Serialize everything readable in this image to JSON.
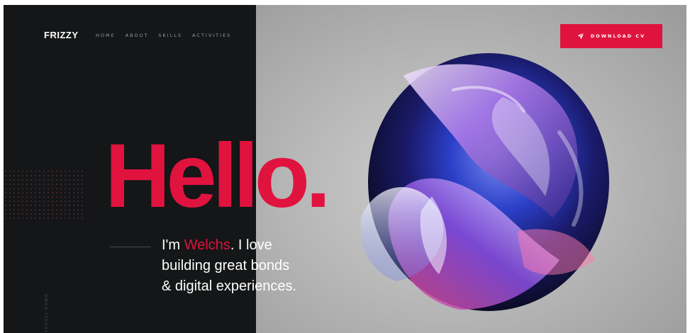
{
  "brand": {
    "logo": "FRIZZY"
  },
  "nav": {
    "items": [
      {
        "label": "HOME"
      },
      {
        "label": "ABOUT"
      },
      {
        "label": "SKILLS"
      },
      {
        "label": "ACTIVITIES"
      }
    ]
  },
  "header": {
    "cta_label": "DOWNLOAD CV",
    "cta_icon": "send-icon"
  },
  "hero": {
    "headline": "Hello.",
    "intro_prefix": "I'm ",
    "intro_name": "Welchs",
    "intro_line1_rest": ". I love",
    "intro_line2": "building great bonds",
    "intro_line3": "& digital experiences.",
    "scroll_label": "SCROLL DOWN"
  },
  "colors": {
    "accent": "#e0133f",
    "dark_panel": "#141617",
    "text_light": "#ffffff",
    "nav_text": "#9a9ea3"
  }
}
